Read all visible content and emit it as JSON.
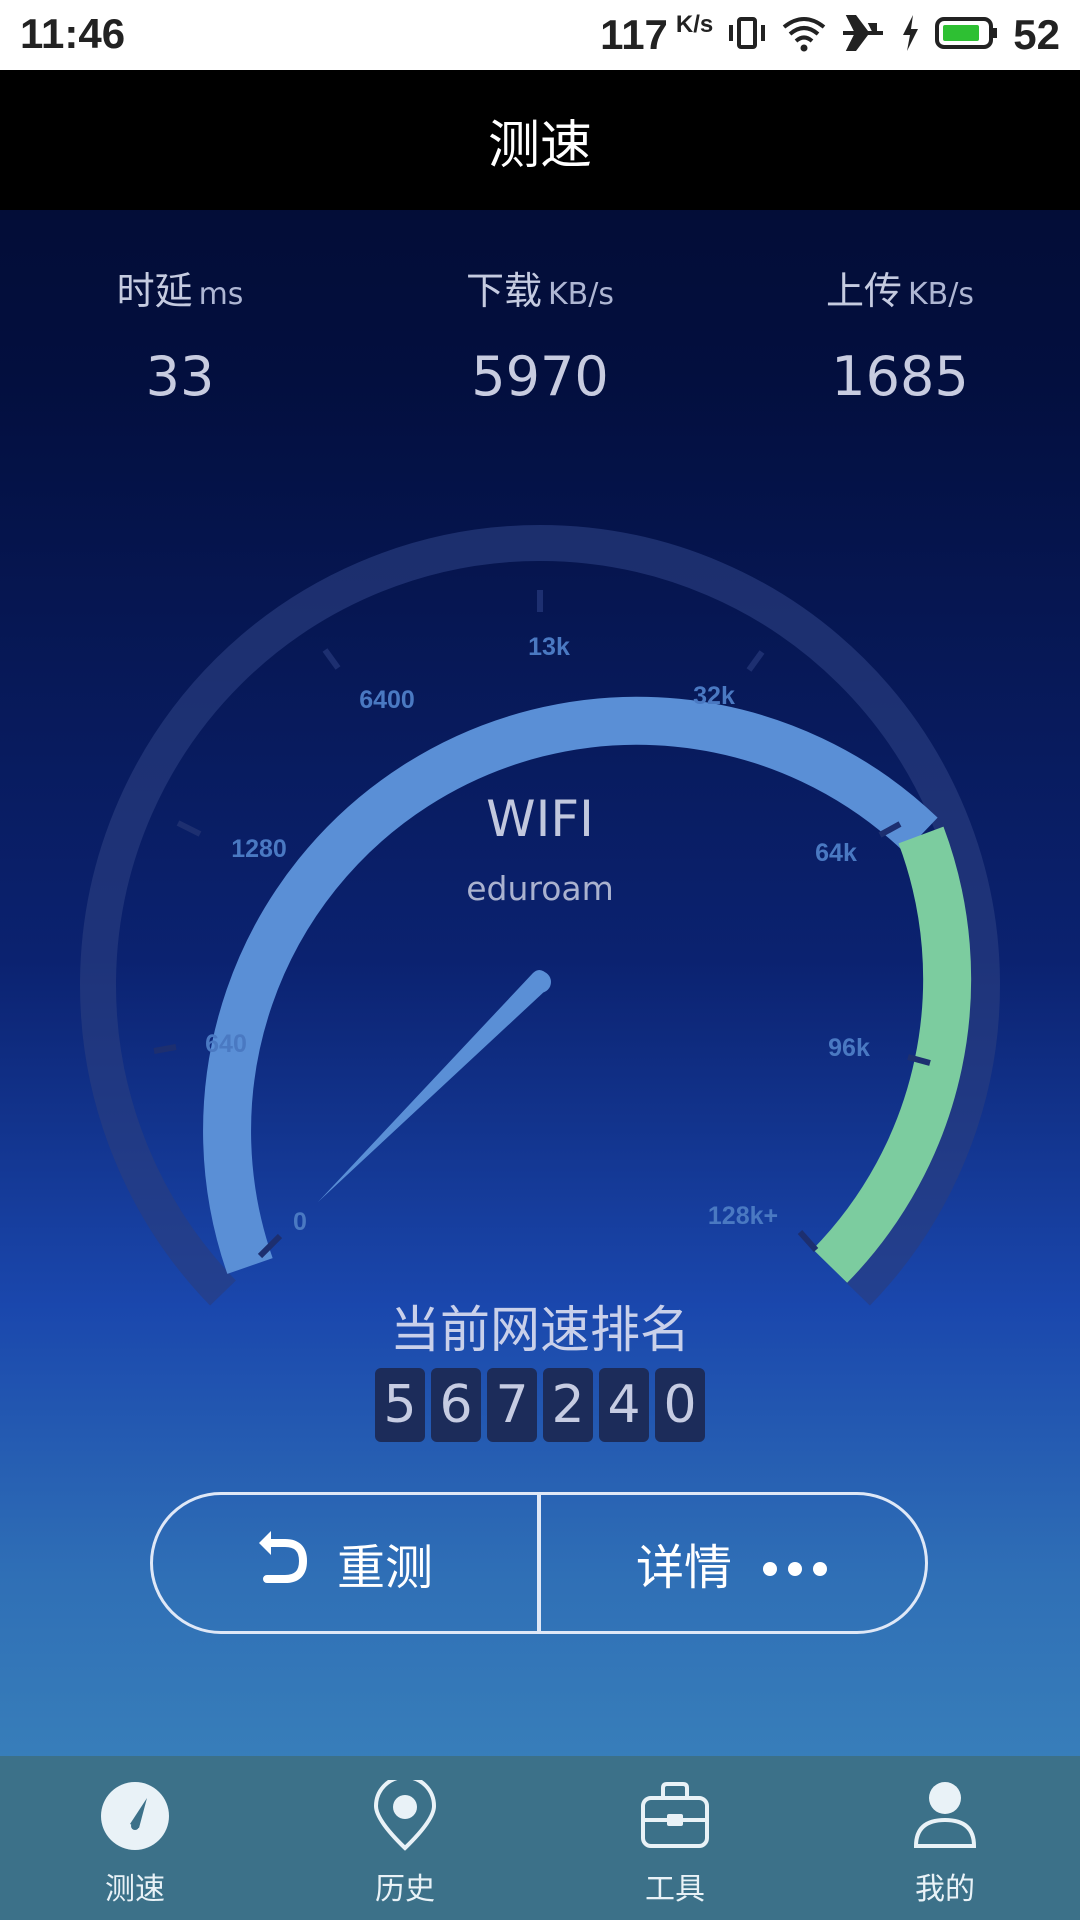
{
  "status_bar": {
    "time": "11:46",
    "net_speed": "117",
    "net_unit": "K/s",
    "battery": "52",
    "icons": [
      "vibrate-icon",
      "wifi-icon",
      "airplane-mode-icon",
      "charging-icon",
      "battery-icon"
    ]
  },
  "app_bar": {
    "title": "测速"
  },
  "metrics": [
    {
      "label": "时延",
      "unit": "ms",
      "value": "33"
    },
    {
      "label": "下载",
      "unit": "KB/s",
      "value": "5970"
    },
    {
      "label": "上传",
      "unit": "KB/s",
      "value": "1685"
    }
  ],
  "gauge": {
    "network_type": "WIFI",
    "network_name": "eduroam",
    "scale_labels": [
      "0",
      "640",
      "1280",
      "6400",
      "13k",
      "32k",
      "64k",
      "96k",
      "128k+"
    ],
    "needle_value_label": "0",
    "arc_color": "#5a8fd6",
    "highlight_color": "#7ccc9f"
  },
  "rank": {
    "title": "当前网速排名",
    "digits": [
      "5",
      "6",
      "7",
      "2",
      "4",
      "0"
    ]
  },
  "actions": {
    "retest_label": "重测",
    "details_label": "详情"
  },
  "nav": [
    {
      "label": "测速",
      "icon": "speedometer-icon",
      "active": true
    },
    {
      "label": "历史",
      "icon": "location-pin-icon",
      "active": false
    },
    {
      "label": "工具",
      "icon": "toolbox-icon",
      "active": false
    },
    {
      "label": "我的",
      "icon": "user-icon",
      "active": false
    }
  ]
}
